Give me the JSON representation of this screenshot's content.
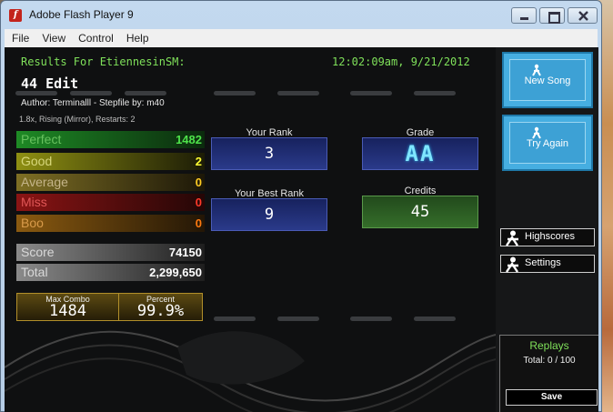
{
  "window": {
    "title": "Adobe Flash Player 9",
    "app_icon": "flash-icon",
    "app_icon_glyph": "f"
  },
  "menu": [
    "File",
    "View",
    "Control",
    "Help"
  ],
  "results": {
    "heading": "Results For EtiennesinSM:",
    "timestamp": "12:02:09am, 9/21/2012",
    "song": "44 Edit",
    "author_line": "Author: Terminalll   -   Stepfile by: m40",
    "mods_line": "1.8x, Rising (Mirror), Restarts: 2"
  },
  "judgements": {
    "perfect": {
      "label": "Perfect",
      "value": "1482"
    },
    "good": {
      "label": "Good",
      "value": "2"
    },
    "average": {
      "label": "Average",
      "value": "0"
    },
    "miss": {
      "label": "Miss",
      "value": "0"
    },
    "boo": {
      "label": "Boo",
      "value": "0"
    }
  },
  "score": {
    "label": "Score",
    "value": "74150"
  },
  "total": {
    "label": "Total",
    "value": "2,299,650"
  },
  "combo": {
    "max_combo_label": "Max Combo",
    "max_combo_value": "1484",
    "percent_label": "Percent",
    "percent_value": "99.9%"
  },
  "rank": {
    "label": "Your Rank",
    "value": "3"
  },
  "best_rank": {
    "label": "Your Best Rank",
    "value": "9"
  },
  "grade": {
    "label": "Grade",
    "value": "AA"
  },
  "credits": {
    "label": "Credits",
    "value": "45"
  },
  "buttons": {
    "new_song": "New Song",
    "try_again": "Try Again",
    "highscores": "Highscores",
    "settings": "Settings"
  },
  "replays": {
    "title": "Replays",
    "total": "Total: 0 / 100",
    "save": "Save"
  },
  "colors": {
    "accent_green": "#7fe05a",
    "button_blue": "#46aee1",
    "rank_box": "#2a3a8a",
    "credits_box": "#356e2a"
  }
}
